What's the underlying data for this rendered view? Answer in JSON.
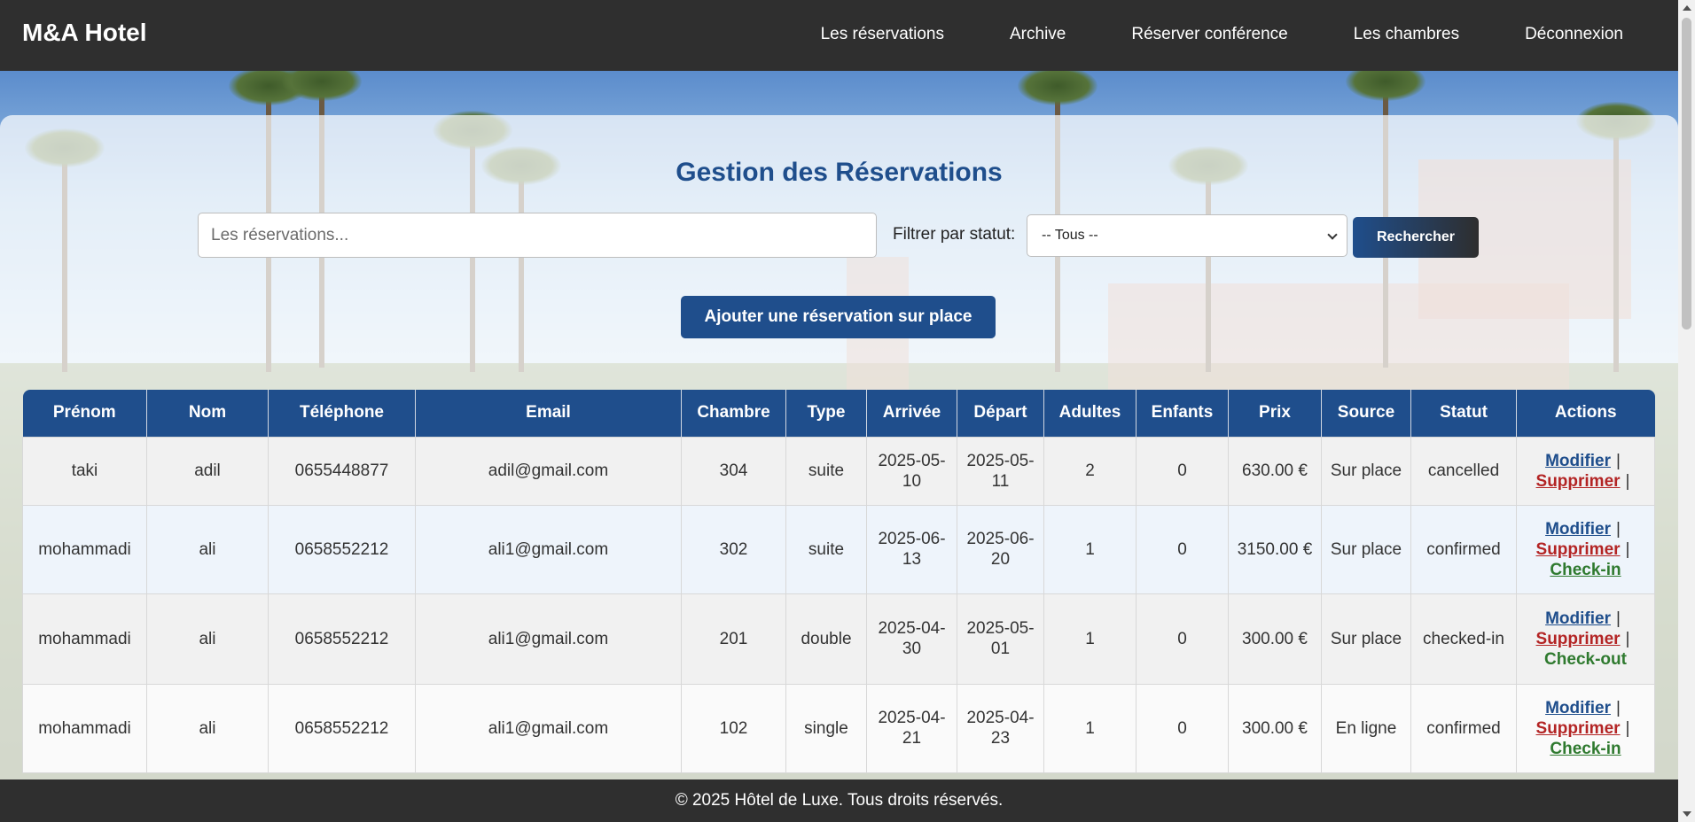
{
  "header": {
    "brand": "M&A Hotel",
    "nav": [
      "Les réservations",
      "Archive",
      "Réserver conférence",
      "Les chambres",
      "Déconnexion"
    ]
  },
  "main": {
    "title": "Gestion des Réservations",
    "search_placeholder": "Les réservations...",
    "filter_label": "Filtrer par statut:",
    "filter_selected": "-- Tous --",
    "search_button": "Rechercher",
    "add_button": "Ajouter une réservation sur place"
  },
  "table": {
    "columns": [
      "Prénom",
      "Nom",
      "Téléphone",
      "Email",
      "Chambre",
      "Type",
      "Arrivée",
      "Départ",
      "Adultes",
      "Enfants",
      "Prix",
      "Source",
      "Statut",
      "Actions"
    ],
    "rows": [
      {
        "prenom": "taki",
        "nom": "adil",
        "telephone": "0655448877",
        "email": "adil@gmail.com",
        "chambre": "304",
        "type": "suite",
        "arrivee": "2025-05-10",
        "depart": "2025-05-11",
        "adultes": "2",
        "enfants": "0",
        "prix": "630.00 €",
        "source": "Sur place",
        "statut": "cancelled"
      },
      {
        "prenom": "mohammadi",
        "nom": "ali",
        "telephone": "0658552212",
        "email": "ali1@gmail.com",
        "chambre": "302",
        "type": "suite",
        "arrivee": "2025-06-13",
        "depart": "2025-06-20",
        "adultes": "1",
        "enfants": "0",
        "prix": "3150.00 €",
        "source": "Sur place",
        "statut": "confirmed"
      },
      {
        "prenom": "mohammadi",
        "nom": "ali",
        "telephone": "0658552212",
        "email": "ali1@gmail.com",
        "chambre": "201",
        "type": "double",
        "arrivee": "2025-04-30",
        "depart": "2025-05-01",
        "adultes": "1",
        "enfants": "0",
        "prix": "300.00 €",
        "source": "Sur place",
        "statut": "checked-in"
      },
      {
        "prenom": "mohammadi",
        "nom": "ali",
        "telephone": "0658552212",
        "email": "ali1@gmail.com",
        "chambre": "102",
        "type": "single",
        "arrivee": "2025-04-21",
        "depart": "2025-04-23",
        "adultes": "1",
        "enfants": "0",
        "prix": "300.00 €",
        "source": "En ligne",
        "statut": "confirmed"
      }
    ],
    "actions": {
      "modify": "Modifier",
      "delete": "Supprimer",
      "checkin": "Check-in",
      "checkout": "Check-out",
      "separator": "|"
    }
  },
  "footer": {
    "text": "© 2025 Hôtel de Luxe. Tous droits réservés."
  }
}
